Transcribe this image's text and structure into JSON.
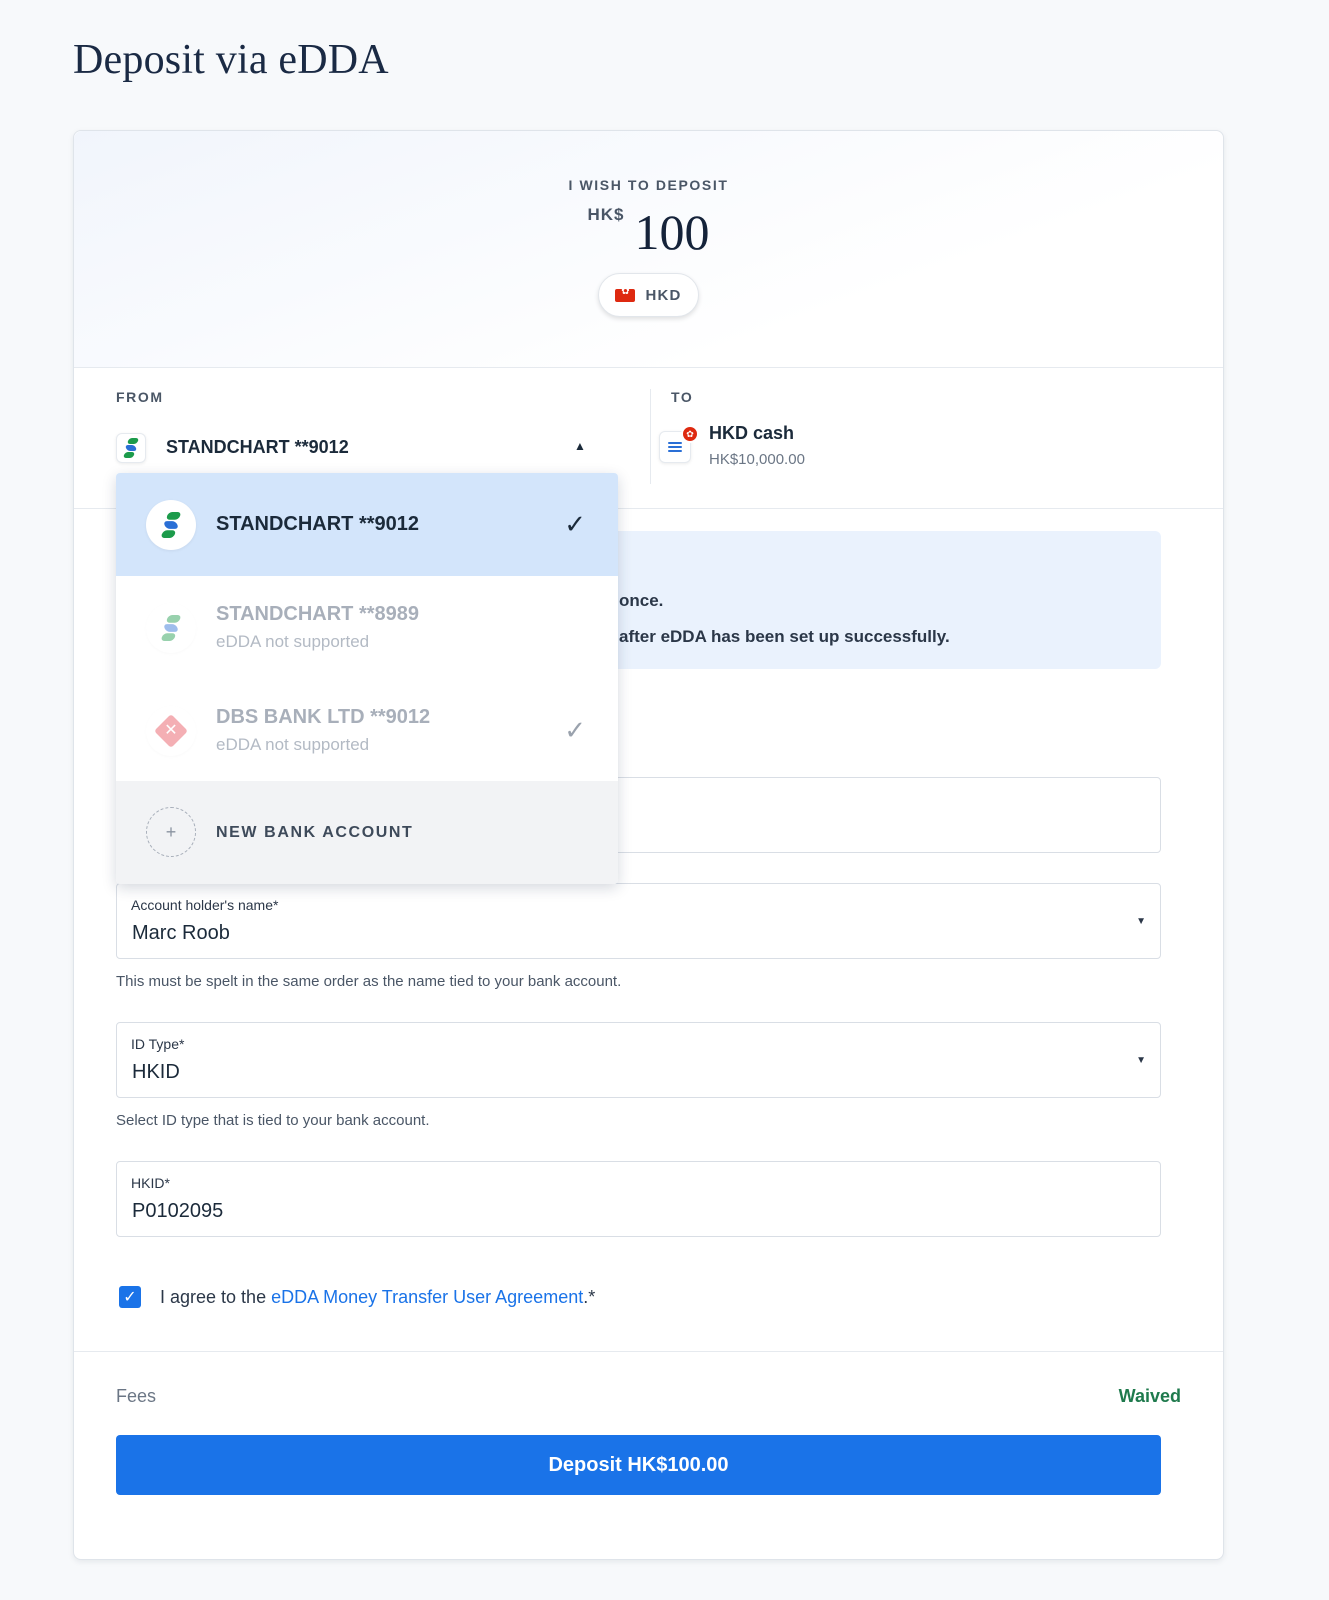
{
  "page": {
    "title": "Deposit via eDDA"
  },
  "hero": {
    "label": "I WISH TO DEPOSIT",
    "currency_symbol": "HK$",
    "amount": "100",
    "currency_code": "HKD",
    "flag_icon": "hong-kong-flag-icon"
  },
  "from": {
    "label": "FROM",
    "selected": "STANDCHART **9012",
    "icon": "standard-chartered-logo-icon"
  },
  "to": {
    "label": "TO",
    "title": "HKD cash",
    "balance": "HK$10,000.00",
    "icon": "cash-account-icon"
  },
  "dropdown": {
    "items": [
      {
        "title": "STANDCHART **9012",
        "subtitle": "",
        "selected": true,
        "icon": "standard-chartered-logo-icon"
      },
      {
        "title": "STANDCHART **8989",
        "subtitle": "eDDA not supported",
        "selected": false,
        "icon": "standard-chartered-logo-icon"
      },
      {
        "title": "DBS BANK LTD **9012",
        "subtitle": "eDDA not supported",
        "selected": false,
        "icon": "dbs-logo-icon"
      }
    ],
    "new_account_label": "NEW BANK ACCOUNT"
  },
  "info": {
    "line1": "once.",
    "line2": "after eDDA has been set up successfully."
  },
  "form": {
    "holder_name": {
      "label": "Account holder's name*",
      "value": "Marc Roob",
      "helper": "This must be spelt in the same order as the name tied to your bank account."
    },
    "id_type": {
      "label": "ID Type*",
      "value": "HKID",
      "helper": "Select ID type that is tied to your bank account."
    },
    "hkid": {
      "label": "HKID*",
      "value": "P0102095"
    }
  },
  "agreement": {
    "prefix": "I agree to the ",
    "link": "eDDA Money Transfer User Agreement",
    "suffix": ".*",
    "checked": true
  },
  "fees": {
    "label": "Fees",
    "value": "Waived"
  },
  "submit": {
    "label": "Deposit HK$100.00"
  },
  "colors": {
    "primary": "#1a73e8",
    "waived": "#1f7a4d",
    "selected_bg": "#d3e5fb",
    "info_bg": "#eaf2fd"
  }
}
